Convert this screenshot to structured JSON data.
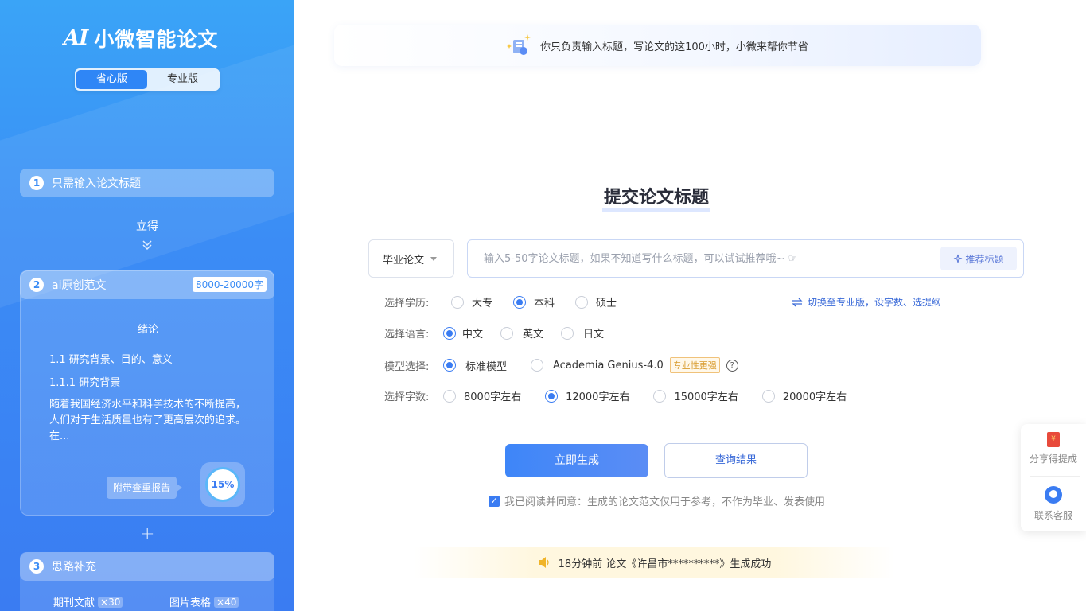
{
  "sidebar": {
    "logo_mark": "AI",
    "logo_text": "小微智能论文",
    "versions": [
      "省心版",
      "专业版"
    ],
    "step1": {
      "num": "1",
      "label": "只需输入论文标题"
    },
    "instant": "立得",
    "step2": {
      "num": "2",
      "label": "ai原创范文",
      "badge": "8000-20000字"
    },
    "sample": {
      "title": "绪论",
      "h1": "1.1 研究背景、目的、意义",
      "h2": "1.1.1 研究背景",
      "para": "随着我国经济水平和科学技术的不断提高，人们对于生活质量也有了更高层次的追求。在...",
      "report_tag": "附带查重报告",
      "percent": "15%"
    },
    "plus": "+",
    "step3": {
      "num": "3",
      "label": "思路补充"
    },
    "extras": [
      {
        "label": "期刊文献",
        "mult": "×30"
      },
      {
        "label": "图片表格",
        "mult": "×40"
      }
    ]
  },
  "banner": {
    "text": "你只负责输入标题，写论文的这100小时，小微来帮你节省"
  },
  "main": {
    "title": "提交论文标题",
    "type_select": "毕业论文",
    "input_placeholder": "输入5-50字论文标题，如果不知道写什么标题，可以试试推荐哦~ ☞",
    "recommend_btn": "推荐标题",
    "education": {
      "label": "选择学历:",
      "options": [
        "大专",
        "本科",
        "硕士"
      ],
      "selected": "本科"
    },
    "switch_link": "切换至专业版，设字数、选提纲",
    "language": {
      "label": "选择语言:",
      "options": [
        "中文",
        "英文",
        "日文"
      ],
      "selected": "中文"
    },
    "model": {
      "label": "模型选择:",
      "options": [
        "标准模型",
        "Academia Genius-4.0"
      ],
      "selected": "标准模型",
      "pro_badge": "专业性更强",
      "help": "?"
    },
    "words": {
      "label": "选择字数:",
      "options": [
        "8000字左右",
        "12000字左右",
        "15000字左右",
        "20000字左右"
      ],
      "selected": "12000字左右"
    },
    "generate_btn": "立即生成",
    "query_btn": "查询结果",
    "agree_text": "我已阅读并同意：生成的论文范文仅用于参考，不作为毕业、发表使用"
  },
  "notice": {
    "text": "18分钟前  论文《许昌市**********》生成成功"
  },
  "float_panel": {
    "share": "分享得提成",
    "service": "联系客服",
    "redpack_symbol": "¥"
  },
  "colors": {
    "primary": "#3a7cf2",
    "sidebar_top": "#3aa4f7",
    "badge_gold": "#d89a2c"
  }
}
